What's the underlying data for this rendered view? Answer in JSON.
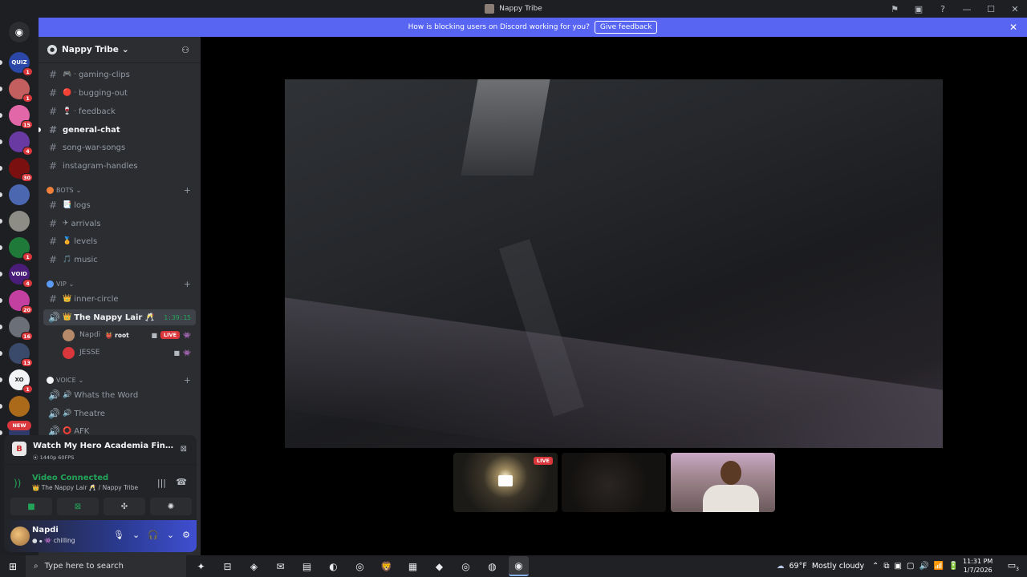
{
  "window": {
    "title": "Nappy Tribe",
    "controls": [
      "⚑",
      "▣",
      "?",
      "—",
      "☐",
      "✕"
    ]
  },
  "banner": {
    "text": "How is blocking users on Discord working for you?",
    "button": "Give feedback",
    "close": "✕"
  },
  "rail": {
    "home_glyph": "◉",
    "new_label": "NEW",
    "servers": [
      {
        "label": "QUIZ",
        "badge": "1",
        "color": "#2b48a8"
      },
      {
        "label": "",
        "badge": "1",
        "color": "#c35f5f"
      },
      {
        "label": "",
        "badge": "15",
        "color": "#e267a8"
      },
      {
        "label": "",
        "badge": "4",
        "color": "#6a3aa3"
      },
      {
        "label": "",
        "badge": "30",
        "color": "#7a1010"
      },
      {
        "label": "",
        "badge": "",
        "color": "#4a67b0"
      },
      {
        "label": "",
        "badge": "",
        "color": "#8d8d85"
      },
      {
        "label": "",
        "badge": "1",
        "color": "#1f7a3a"
      },
      {
        "label": "VOID",
        "badge": "4",
        "color": "#4a1d7a"
      },
      {
        "label": "",
        "badge": "20",
        "color": "#c33fa0"
      },
      {
        "label": "",
        "badge": "16",
        "color": "#6b6f77"
      },
      {
        "label": "",
        "badge": "13",
        "color": "#3a4a6a"
      },
      {
        "label": "XO",
        "badge": "1",
        "color": "#f2f3f5"
      },
      {
        "label": "",
        "badge": "",
        "color": "#aa6a1a"
      },
      {
        "label": "",
        "badge": "",
        "color": "#2e3a6a"
      }
    ]
  },
  "guild": {
    "name": "Nappy Tribe",
    "chevron": "⌄",
    "invite_icon": "⚇"
  },
  "channels_top": [
    {
      "icon": "#",
      "emoji": "🎮 ·",
      "name": "gaming-clips",
      "active": false
    },
    {
      "icon": "#",
      "emoji": "🔴 ·",
      "name": "bugging-out",
      "active": false
    },
    {
      "icon": "#",
      "emoji": "🍷 ·",
      "name": "feedback",
      "active": false
    },
    {
      "icon": "#",
      "emoji": "",
      "name": "general-chat",
      "active": true
    },
    {
      "icon": "#",
      "emoji": "",
      "name": "song-war-songs",
      "active": false
    },
    {
      "icon": "#",
      "emoji": "",
      "name": "instagram-handles",
      "active": false
    }
  ],
  "categories": {
    "bots": {
      "label": "BOTS",
      "color": "#f0803a"
    },
    "vip": {
      "label": "VIP",
      "color": "#5b9bf3"
    },
    "voice": {
      "label": "VOICE",
      "color": "#f2f3f5"
    }
  },
  "bots_channels": [
    {
      "icon": "#",
      "emoji": "📑",
      "name": "logs"
    },
    {
      "icon": "#",
      "emoji": "✈",
      "name": "arrivals"
    },
    {
      "icon": "#",
      "emoji": "🏅",
      "name": "levels"
    },
    {
      "icon": "#",
      "emoji": "🎵",
      "name": "music"
    }
  ],
  "vip_channels": {
    "text": {
      "icon": "#",
      "emoji": "👑",
      "name": "inner-circle"
    },
    "voice": {
      "icon": "🔊",
      "emoji": "👑",
      "name": "The Nappy Lair 🥂",
      "timer": "1:39:15"
    }
  },
  "voice_users": [
    {
      "name": "Napdi",
      "tag": "👹 root",
      "live": "LIVE",
      "avatar_color": "#b58a6a"
    },
    {
      "name": "JESSE",
      "tag": "",
      "live": "",
      "avatar_color": "#da373c"
    }
  ],
  "voice_channels": [
    {
      "icon": "🔊",
      "emoji": "🔊",
      "name": "Whats the Word"
    },
    {
      "icon": "🔊",
      "emoji": "🔊",
      "name": "Theatre"
    },
    {
      "icon": "🔊",
      "emoji": "⭕",
      "name": "AFK"
    }
  ],
  "activity": {
    "icon": "B",
    "title": "Watch My Hero Academia Final Sea...",
    "subtitle": "⦿ 1440p 60FPS",
    "close": "⊠"
  },
  "connection": {
    "status": "Video Connected",
    "location": "👑 The Nappy Lair 🥂 / Nappy Tribe",
    "signal_icon": "))",
    "noise_icon": "|||",
    "disconnect_icon": "☎",
    "buttons": [
      {
        "name": "camera",
        "glyph": "■"
      },
      {
        "name": "screen-share",
        "glyph": "⊠"
      },
      {
        "name": "activities",
        "glyph": "✣"
      },
      {
        "name": "soundboard",
        "glyph": "✺"
      }
    ]
  },
  "user": {
    "name": "Napdi",
    "status": "● ⦁ 👾 chilling",
    "controls": [
      "🎙",
      "⌄",
      "🎧",
      "⌄",
      "⚙"
    ]
  },
  "stage": {
    "tiles": [
      {
        "live": "LIVE"
      },
      {
        "live": ""
      },
      {
        "live": ""
      }
    ]
  },
  "taskbar": {
    "search_placeholder": "Type here to search",
    "apps": [
      "✦",
      "⊟",
      "◈",
      "✉",
      "▤",
      "◐",
      "◎",
      "🦁",
      "▦",
      "◆",
      "◎",
      "◍",
      "◉"
    ],
    "weather_temp": "69°F",
    "weather_desc": "Mostly cloudy",
    "tray": [
      "⌃",
      "⧉",
      "▣",
      "▢",
      "🔊",
      "📶",
      "🔋"
    ],
    "time": "11:31 PM",
    "date": "1/7/2026",
    "notifications": "3"
  }
}
